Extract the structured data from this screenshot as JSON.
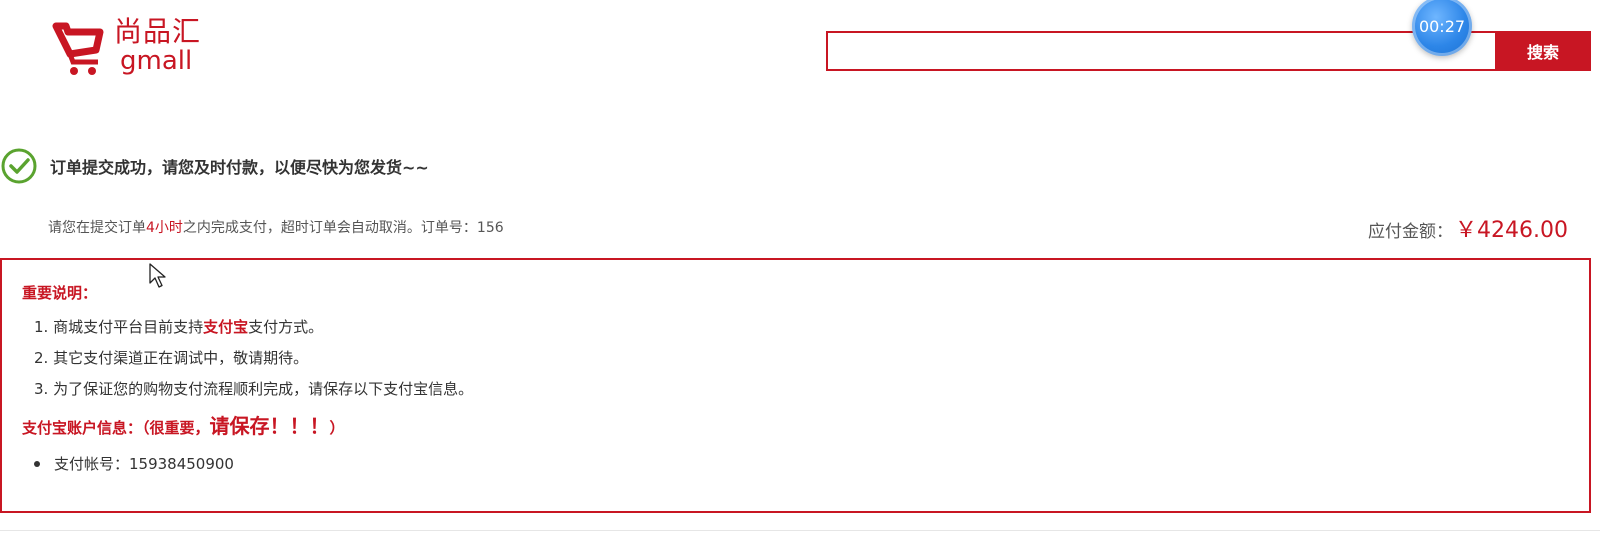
{
  "header": {
    "logo_cn": "尚品汇",
    "logo_en": "gmall",
    "search_placeholder": "",
    "search_button": "搜索",
    "timer": "00:27"
  },
  "success": {
    "message": "订单提交成功，请您及时付款，以便尽快为您发货~~",
    "notice_prefix": "请您在提交订单",
    "notice_hours": "4小时",
    "notice_suffix": "之内完成支付，超时订单会自动取消。订单号：156",
    "amount_label": "应付金额：",
    "amount_value": "￥4246.00"
  },
  "info": {
    "title": "重要说明：",
    "items": [
      {
        "prefix": "1. 商城支付平台目前支持",
        "highlight": "支付宝",
        "suffix": "支付方式。"
      },
      {
        "text": "2. 其它支付渠道正在调试中，敬请期待。"
      },
      {
        "text": "3. 为了保证您的购物支付流程顺利完成，请保存以下支付宝信息。"
      }
    ],
    "account_title": "支付宝账户信息：（很重要，",
    "account_title_big": "请保存！！！",
    "account_title_end": "）",
    "account_line": "支付帐号：15938450900"
  },
  "colors": {
    "brand_red": "#c81623",
    "success_green": "#5aa32f",
    "timer_blue": "#2d86e8"
  },
  "icons": [
    "cart-icon",
    "check-circle-icon",
    "mouse-cursor-icon"
  ]
}
